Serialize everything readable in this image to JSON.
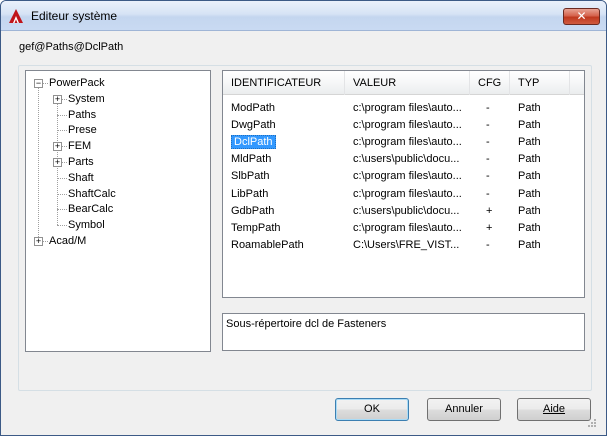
{
  "window": {
    "title": "Editeur système",
    "close_label": "✕"
  },
  "path_label": "gef@Paths@DclPath",
  "tree": {
    "items": [
      {
        "label": "PowerPack",
        "expander": "−"
      },
      {
        "label": "System",
        "expander": "+"
      },
      {
        "label": "Paths",
        "expander": ""
      },
      {
        "label": "Prese",
        "expander": ""
      },
      {
        "label": "FEM",
        "expander": "+"
      },
      {
        "label": "Parts",
        "expander": "+"
      },
      {
        "label": "Shaft",
        "expander": ""
      },
      {
        "label": "ShaftCalc",
        "expander": ""
      },
      {
        "label": "BearCalc",
        "expander": ""
      },
      {
        "label": "Symbol",
        "expander": ""
      },
      {
        "label": "Acad/M",
        "expander": "+"
      }
    ]
  },
  "list": {
    "columns": [
      "IDENTIFICATEUR",
      "VALEUR",
      "CFG",
      "TYP"
    ],
    "rows": [
      {
        "id": "ModPath",
        "value": "c:\\program files\\auto...",
        "cfg": "-",
        "typ": "Path"
      },
      {
        "id": "DwgPath",
        "value": "c:\\program files\\auto...",
        "cfg": "-",
        "typ": "Path"
      },
      {
        "id": "DclPath",
        "value": "c:\\program files\\auto...",
        "cfg": "-",
        "typ": "Path"
      },
      {
        "id": "MldPath",
        "value": "c:\\users\\public\\docu...",
        "cfg": "-",
        "typ": "Path"
      },
      {
        "id": "SlbPath",
        "value": "c:\\program files\\auto...",
        "cfg": "-",
        "typ": "Path"
      },
      {
        "id": "LibPath",
        "value": "c:\\program files\\auto...",
        "cfg": "-",
        "typ": "Path"
      },
      {
        "id": "GdbPath",
        "value": "c:\\users\\public\\docu...",
        "cfg": "+",
        "typ": "Path"
      },
      {
        "id": "TempPath",
        "value": "c:\\program files\\auto...",
        "cfg": "+",
        "typ": "Path"
      },
      {
        "id": "RoamablePath",
        "value": "C:\\Users\\FRE_VIST...",
        "cfg": "-",
        "typ": "Path"
      }
    ],
    "selected_index": 2
  },
  "description": "Sous-répertoire dcl de Fasteners",
  "buttons": {
    "ok": "OK",
    "cancel": "Annuler",
    "help": "Aide"
  },
  "colors": {
    "selection": "#3399ff",
    "close_button": "#c0391f"
  }
}
